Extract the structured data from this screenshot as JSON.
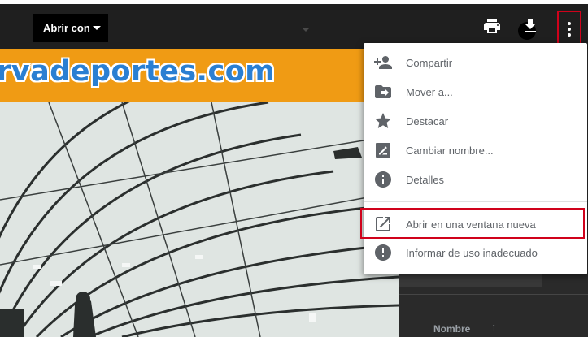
{
  "toolbar": {
    "open_with_label": "Abrir con",
    "print_icon": "print-icon",
    "download_icon": "download-icon",
    "more_icon": "more-vert-icon"
  },
  "banner": {
    "logo_text": "rvadeportes.com"
  },
  "menu": {
    "items": [
      {
        "label": "Compartir",
        "icon": "person-add-icon"
      },
      {
        "label": "Mover a...",
        "icon": "move-to-folder-icon"
      },
      {
        "label": "Destacar",
        "icon": "star-icon"
      },
      {
        "label": "Cambiar nombre...",
        "icon": "rename-icon"
      },
      {
        "label": "Detalles",
        "icon": "info-icon"
      },
      {
        "label": "Abrir en una ventana nueva",
        "icon": "open-in-new-icon"
      },
      {
        "label": "Informar de uso inadecuado",
        "icon": "report-icon"
      }
    ]
  },
  "right_pane": {
    "sort_label": "Nombre",
    "sort_arrow": "↑"
  },
  "colors": {
    "toolbar": "#1f1f1f",
    "banner": "#f09b14",
    "logo_blue": "#2a7fd2",
    "highlight": "#d0021b",
    "menu_text": "#5f6368"
  }
}
